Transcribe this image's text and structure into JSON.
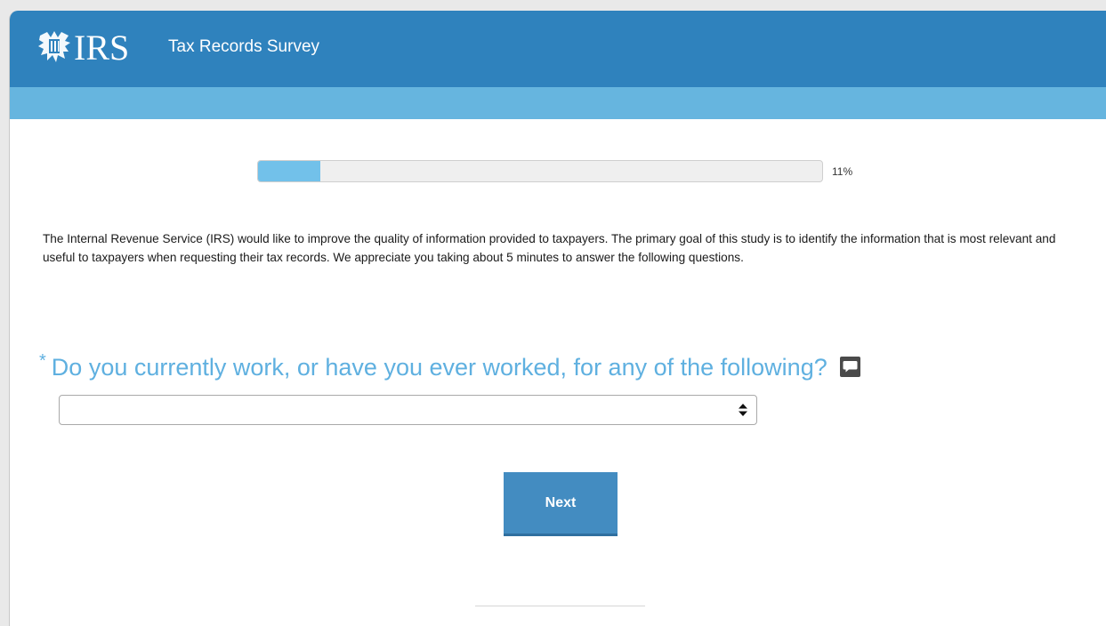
{
  "header": {
    "logo_text": "IRS",
    "title": "Tax Records Survey"
  },
  "progress": {
    "value": 0.11,
    "label": "11%"
  },
  "intro": {
    "text": "The Internal Revenue Service (IRS) would like to improve the quality of information provided to taxpayers.  The primary goal of this study is to identify the information that is most relevant and useful to taxpayers when requesting their tax records.  We appreciate you taking about 5 minutes to answer the following questions."
  },
  "question": {
    "required_marker": "*",
    "text": "Do you currently work, or have you ever worked, for any of the following?",
    "comment_icon": "speech-bubble-icon"
  },
  "select": {
    "value": "",
    "icon": "sort-arrows-icon"
  },
  "actions": {
    "next_label": "Next"
  },
  "colors": {
    "header": "#2f82bd",
    "subbar": "#66b5df",
    "progress_fill": "#72c1ea",
    "question": "#5fb0e0",
    "button": "#438cc1"
  }
}
